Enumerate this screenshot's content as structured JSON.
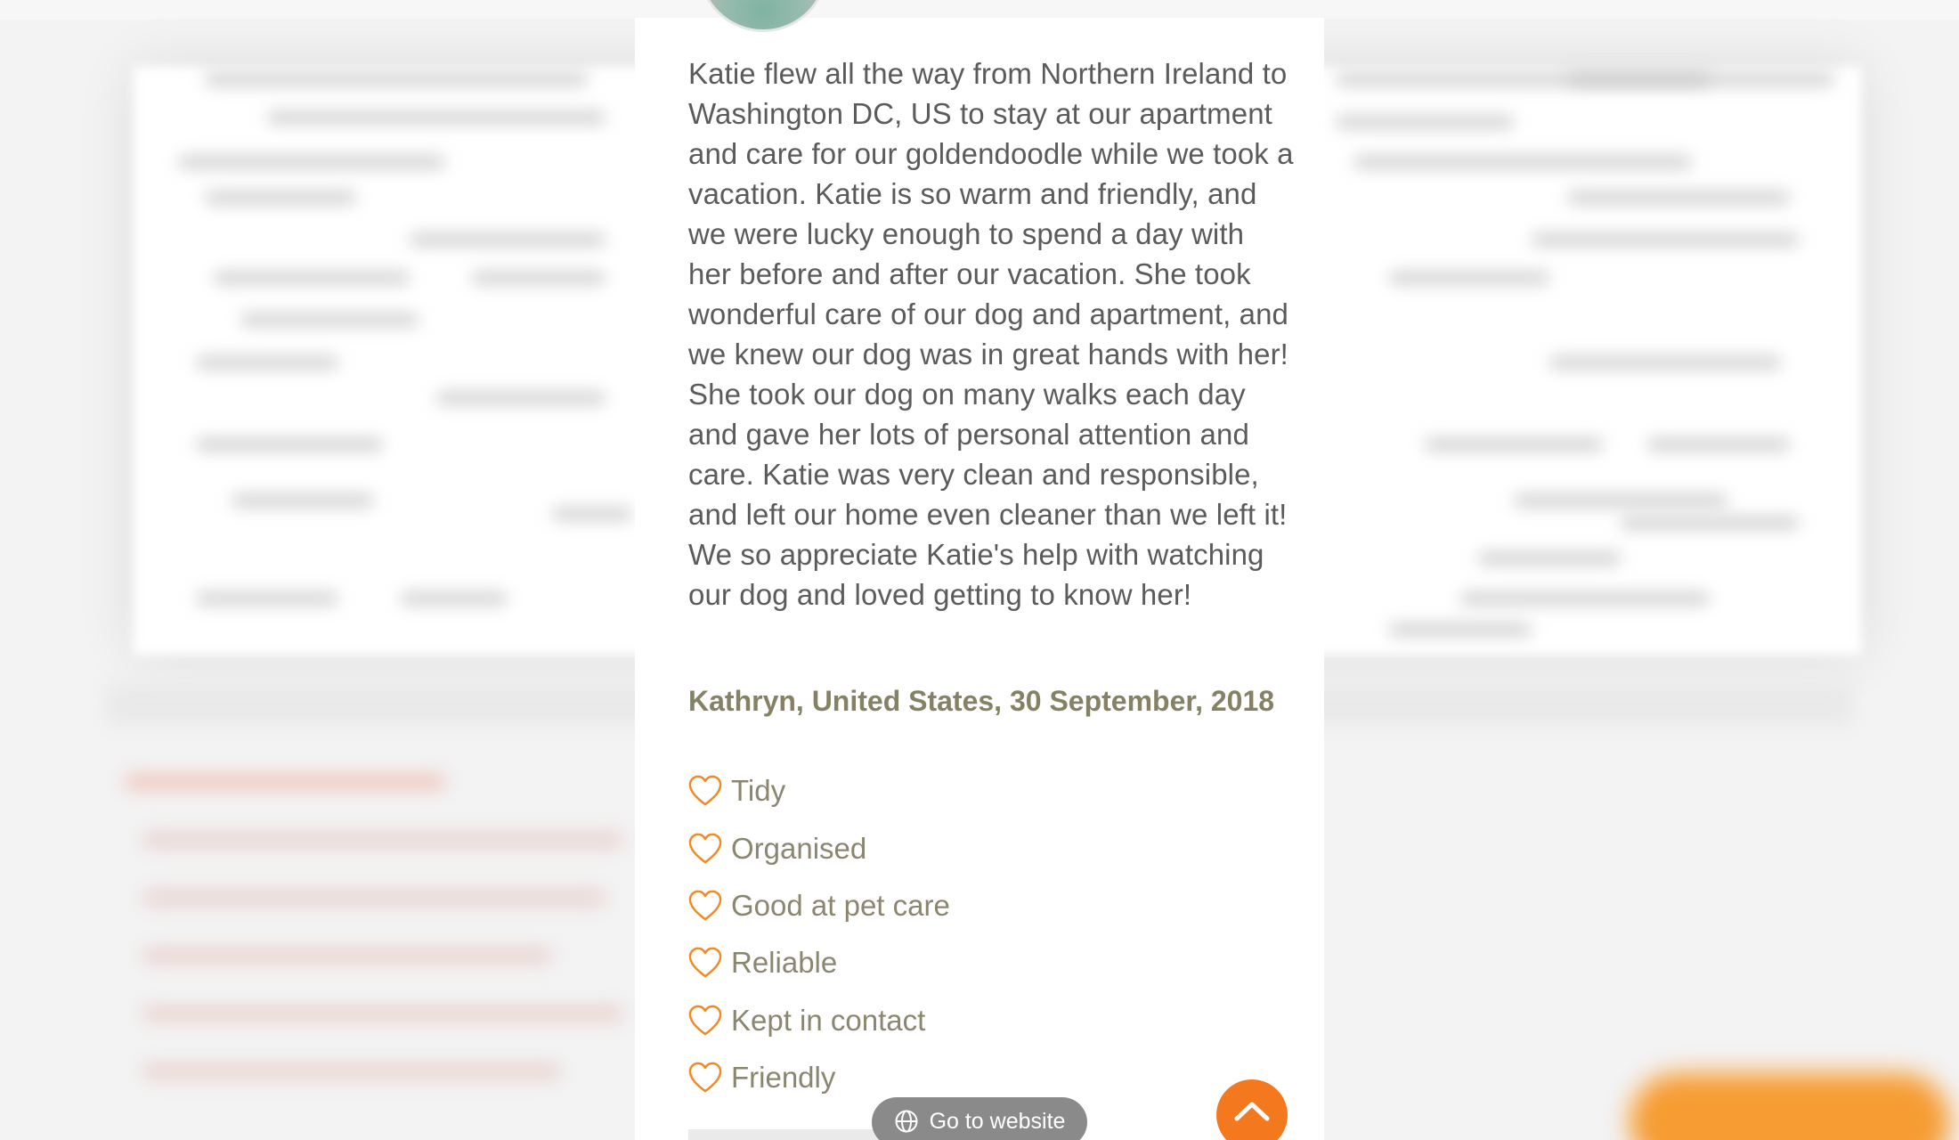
{
  "review": {
    "text": "Katie flew all the way from Northern Ireland to Washington DC, US to stay at our apartment and care for our goldendoodle while we took a vacation. Katie is so warm and friendly, and we were lucky enough to spend a day with her before and after our vacation. She took wonderful care of our dog and apartment, and we knew our dog was in great hands with her! She took our dog on many walks each day and gave her lots of personal attention and care. Katie was very clean and responsible, and left our home even cleaner than we left it! We so appreciate Katie's help with watching our dog and loved getting to know her!",
    "author_line": "Kathryn, United States, 30 September, 2018",
    "traits": [
      {
        "label": "Tidy",
        "icon": "heart-outline-icon"
      },
      {
        "label": "Organised",
        "icon": "heart-outline-icon"
      },
      {
        "label": "Good at pet care",
        "icon": "heart-outline-icon"
      },
      {
        "label": "Reliable",
        "icon": "heart-outline-icon"
      },
      {
        "label": "Kept in contact",
        "icon": "heart-outline-icon"
      },
      {
        "label": "Friendly",
        "icon": "heart-outline-icon"
      }
    ]
  },
  "go_website": {
    "label": "Go to website",
    "icon": "globe-icon"
  },
  "scroll_top": {
    "icon": "chevron-up-icon"
  },
  "colors": {
    "accent_orange": "#f4781e",
    "heart_orange": "#f08a24",
    "body_text": "#5b5b5b",
    "author_text": "#858165",
    "trait_text": "#8a8670",
    "pill_gray": "#8a8a8a"
  }
}
